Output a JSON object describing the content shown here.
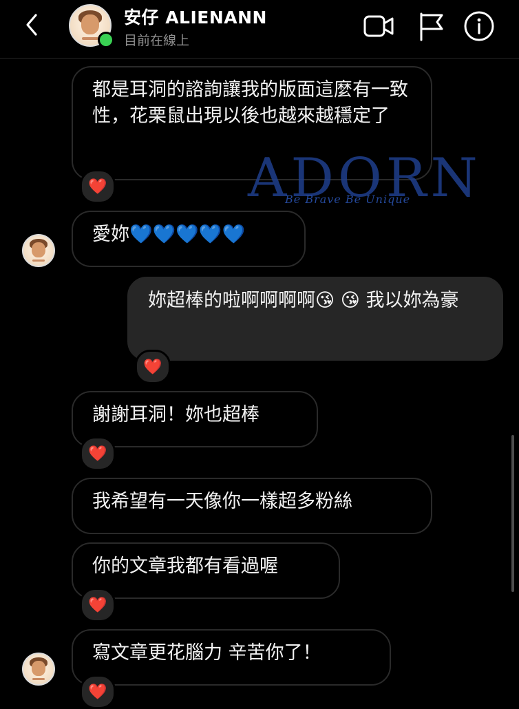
{
  "header": {
    "title": "安仔 ALIENANN",
    "status": "目前在線上"
  },
  "watermark": {
    "main": "ADORN",
    "sub": "Be Brave Be Unique"
  },
  "messages": [
    {
      "text": "都是耳洞的諮詢讓我的版面這麼有一致性，花栗鼠出現以後也越來越穩定了",
      "reaction": "❤️"
    },
    {
      "text": "愛妳💙💙💙💙💙"
    },
    {
      "text": "妳超棒的啦啊啊啊啊😘 😘 我以妳為豪",
      "reaction": "❤️"
    },
    {
      "text": "謝謝耳洞！妳也超棒",
      "reaction": "❤️"
    },
    {
      "text": "我希望有一天像你一樣超多粉絲"
    },
    {
      "text": "你的文章我都有看過喔",
      "reaction": "❤️"
    },
    {
      "text": "寫文章更花腦力 辛苦你了！",
      "reaction": "❤️"
    }
  ],
  "colors": {
    "background": "#000000",
    "incoming_border": "#2a2a2a",
    "outgoing_bg": "#262626",
    "online": "#3ad153",
    "heart": "#e0243c"
  }
}
